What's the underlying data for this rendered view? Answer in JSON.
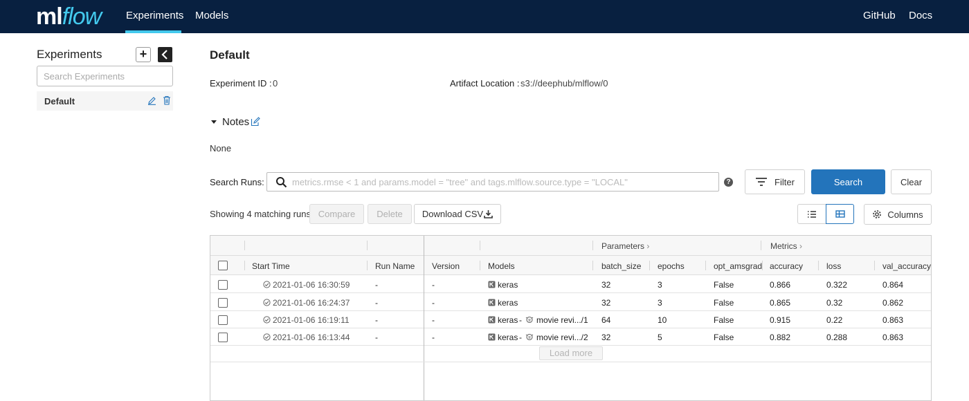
{
  "nav": {
    "logo_ml": "ml",
    "logo_flow": "flow",
    "experiments": "Experiments",
    "models": "Models",
    "github": "GitHub",
    "docs": "Docs",
    "bg_color": "#082040",
    "accent_color": "#43c9ed"
  },
  "sidebar": {
    "title": "Experiments",
    "add_icon": "plus-icon",
    "collapse_icon": "chevron-left-icon",
    "search_placeholder": "Search Experiments",
    "items": [
      {
        "label": "Default",
        "edit_icon": "pencil-icon",
        "delete_icon": "trash-icon"
      }
    ]
  },
  "experiment": {
    "title": "Default",
    "id_label": "Experiment ID :",
    "id_value": "0",
    "artifact_label": "Artifact Location :",
    "artifact_value": "s3://deephub/mlflow/0",
    "notes_label": "Notes",
    "notes_value": "None"
  },
  "search": {
    "label": "Search Runs:",
    "placeholder": "metrics.rmse < 1 and params.model = \"tree\" and tags.mlflow.source.type = \"LOCAL\"",
    "help": "?",
    "filter_label": "Filter",
    "search_label": "Search",
    "clear_label": "Clear"
  },
  "toolbar": {
    "matching_text": "Showing 4 matching runs",
    "compare_label": "Compare",
    "delete_label": "Delete",
    "download_label": "Download CSV",
    "columns_label": "Columns",
    "primary_color": "#2374bb"
  },
  "table": {
    "group_params": "Parameters",
    "group_metrics": "Metrics",
    "headers": [
      "Start Time",
      "Run Name",
      "Version",
      "Models",
      "batch_size",
      "epochs",
      "opt_amsgrad",
      "accuracy",
      "loss",
      "val_accuracy"
    ],
    "rows": [
      {
        "start_time": "2021-01-06 16:30:59",
        "run_name": "-",
        "version": "-",
        "model": "keras",
        "model_extra": "",
        "batch_size": "32",
        "epochs": "3",
        "opt_amsgrad": "False",
        "accuracy": "0.866",
        "loss": "0.322",
        "val_accuracy": "0.864"
      },
      {
        "start_time": "2021-01-06 16:24:37",
        "run_name": "-",
        "version": "-",
        "model": "keras",
        "model_extra": "",
        "batch_size": "32",
        "epochs": "3",
        "opt_amsgrad": "False",
        "accuracy": "0.865",
        "loss": "0.32",
        "val_accuracy": "0.862"
      },
      {
        "start_time": "2021-01-06 16:19:11",
        "run_name": "-",
        "version": "-",
        "model": "keras",
        "model_extra": "movie revi.../1",
        "batch_size": "64",
        "epochs": "10",
        "opt_amsgrad": "False",
        "accuracy": "0.915",
        "loss": "0.22",
        "val_accuracy": "0.863"
      },
      {
        "start_time": "2021-01-06 16:13:44",
        "run_name": "-",
        "version": "-",
        "model": "keras",
        "model_extra": "movie revi.../2",
        "batch_size": "32",
        "epochs": "5",
        "opt_amsgrad": "False",
        "accuracy": "0.882",
        "loss": "0.288",
        "val_accuracy": "0.863"
      }
    ],
    "load_more": "Load more",
    "dash": "-"
  }
}
